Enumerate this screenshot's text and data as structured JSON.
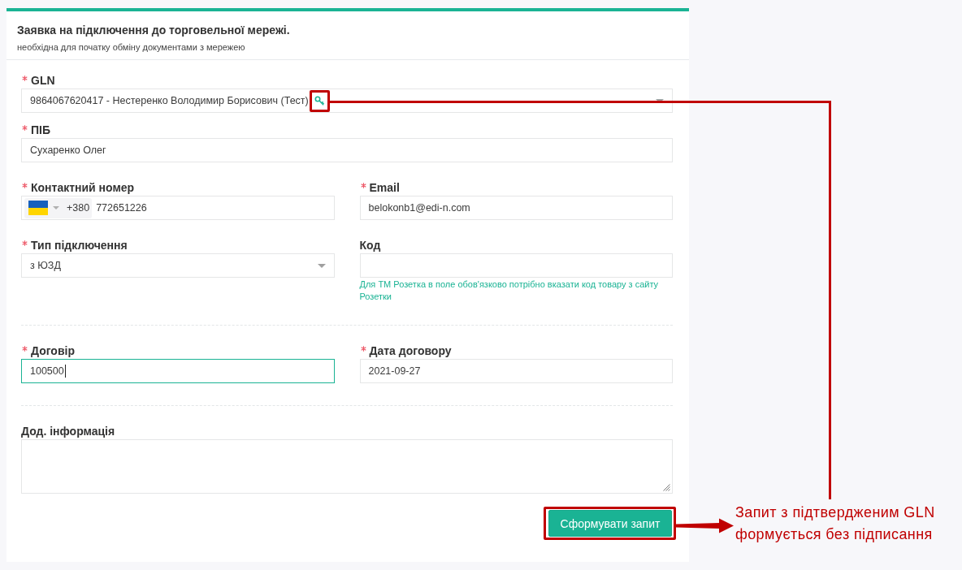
{
  "form": {
    "title": "Заявка на підключення до торговельної мережі.",
    "subtitle": "необхідна для початку обміну документами з мережею",
    "sections": [
      {
        "rows": [
          {
            "fields": [
              {
                "kind": "select",
                "label": "GLN",
                "required": true,
                "value": "9864067620417 - Нестеренко Володимир Борисович (Тест)",
                "confirmed": true,
                "highlighted": true,
                "focused": false
              }
            ]
          },
          {
            "fields": [
              {
                "kind": "text",
                "label": "ПІБ",
                "required": true,
                "value": "Сухаренко Олег",
                "focused": false
              }
            ]
          },
          {
            "fields": [
              {
                "kind": "phone",
                "label": "Контактний номер",
                "required": true,
                "dial_code": "+380",
                "value": "772651226",
                "focused": false
              },
              {
                "kind": "text",
                "label": "Email",
                "required": true,
                "value": "belokonb1@edi-n.com",
                "focused": false
              }
            ]
          },
          {
            "fields": [
              {
                "kind": "select",
                "label": "Тип підключення",
                "required": true,
                "value": "з ЮЗД",
                "focused": false
              },
              {
                "kind": "text",
                "label": "Код",
                "required": false,
                "focused": false,
                "hint": "Для ТМ Розетка в поле обов'язково потрібно вказати код товару з сайту Розетки"
              }
            ]
          }
        ]
      },
      {
        "rows": [
          {
            "fields": [
              {
                "kind": "text",
                "label": "Договір",
                "required": true,
                "value": "100500",
                "focused": true
              },
              {
                "kind": "text",
                "label": "Дата договору",
                "required": true,
                "value": "2021-09-27",
                "focused": false
              }
            ]
          }
        ]
      },
      {
        "rows": [
          {
            "fields": [
              {
                "kind": "textarea",
                "label": "Дод. інформація",
                "required": false,
                "focused": false
              }
            ]
          }
        ]
      }
    ],
    "submit": {
      "label": "Сформувати запит",
      "highlighted": true
    }
  },
  "callout": {
    "text": "Запит з підтвердженим GLN формується без підписання"
  }
}
